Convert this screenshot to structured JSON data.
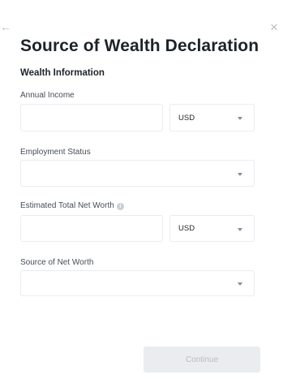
{
  "dialog": {
    "back_icon": "←",
    "close_icon": "×",
    "title": "Source of Wealth Declaration",
    "section_title": "Wealth Information"
  },
  "fields": {
    "annual_income": {
      "label": "Annual Income",
      "value": "",
      "currency": "USD"
    },
    "employment_status": {
      "label": "Employment Status",
      "selected": ""
    },
    "net_worth": {
      "label": "Estimated Total Net Worth",
      "info_icon": "i",
      "value": "",
      "currency": "USD"
    },
    "source_of_net_worth": {
      "label": "Source of Net Worth",
      "selected": ""
    }
  },
  "actions": {
    "continue_label": "Continue"
  },
  "icons": [
    "back-arrow-icon",
    "close-icon",
    "info-icon",
    "chevron-down-icon"
  ],
  "colors": {
    "border": "#eaecef",
    "label_text": "#474d57",
    "heading_text": "#1e2329",
    "disabled_button_bg": "#eaecef",
    "disabled_button_text": "#b7bdc6"
  }
}
